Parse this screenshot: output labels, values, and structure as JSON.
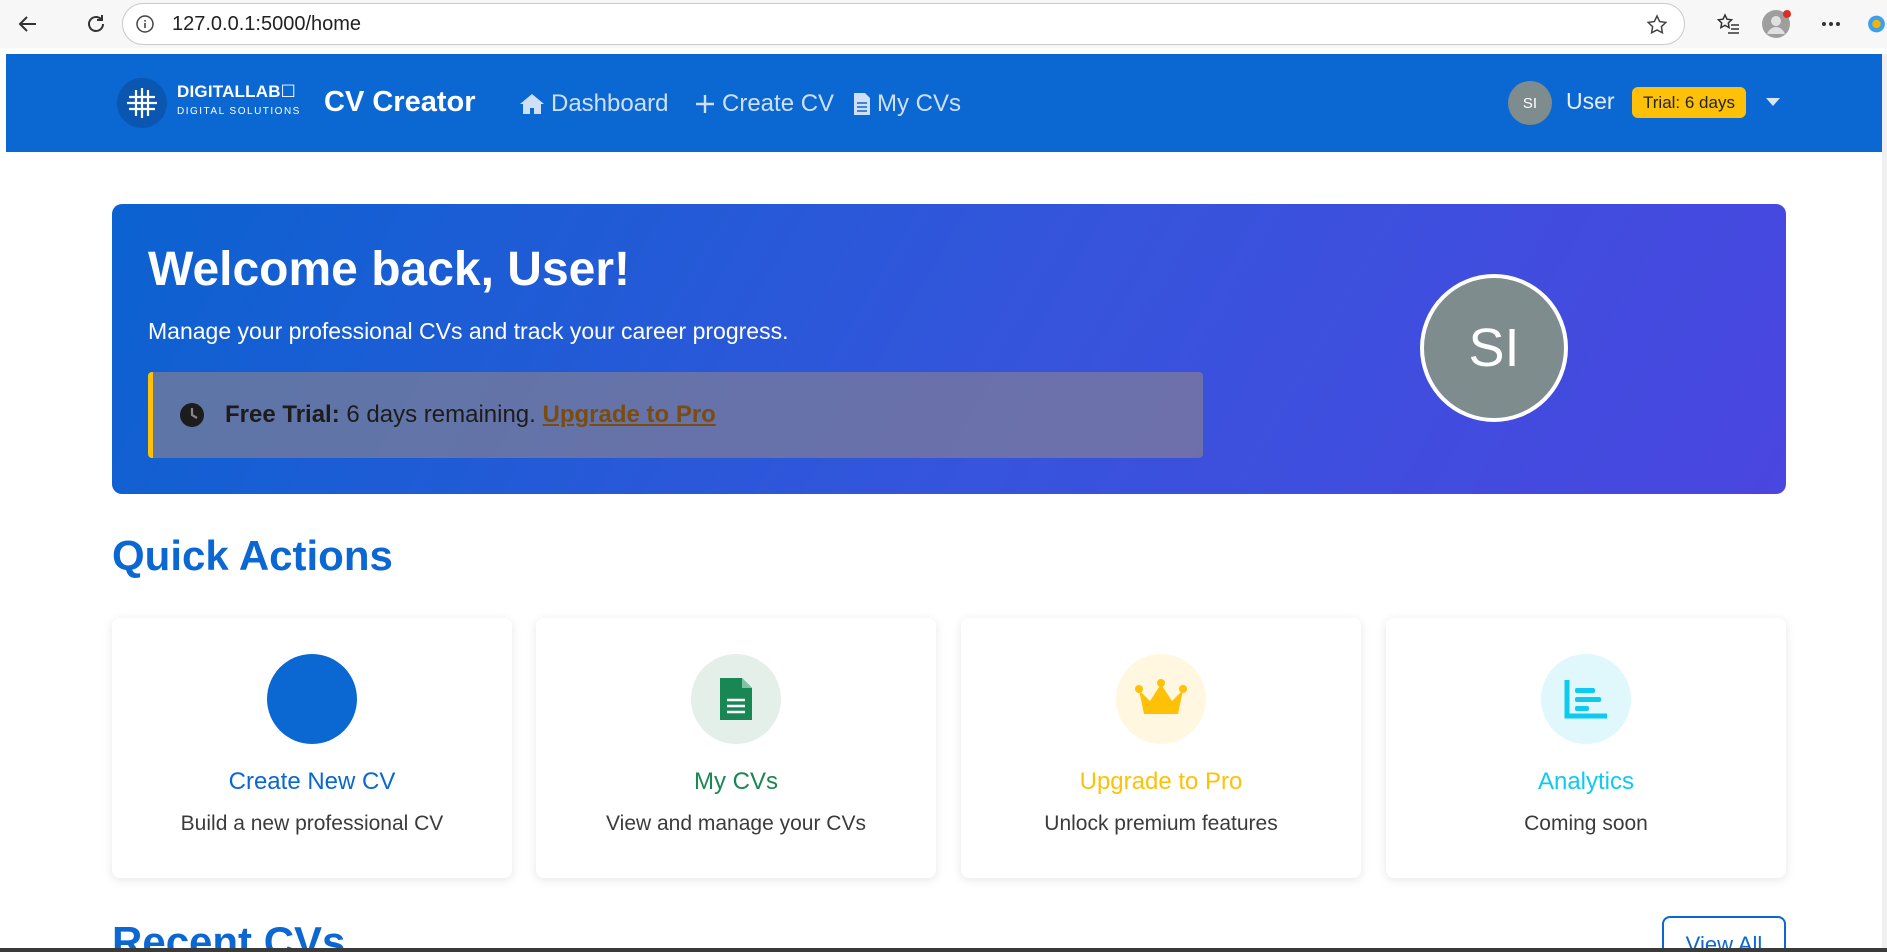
{
  "browser": {
    "url": "127.0.0.1:5000/home"
  },
  "navbar": {
    "logo_main": "DIGITALLAB☐",
    "logo_sub": "DIGITAL SOLUTIONS",
    "brand": "CV Creator",
    "links": [
      {
        "label": "Dashboard",
        "icon": "home-icon"
      },
      {
        "label": "Create CV",
        "icon": "plus-icon"
      },
      {
        "label": "My CVs",
        "icon": "file-icon"
      }
    ],
    "user_initials": "SI",
    "user_name": "User",
    "trial_badge": "Trial: 6 days"
  },
  "hero": {
    "title": "Welcome back, User!",
    "subtitle": "Manage your professional CVs and track your career progress.",
    "trial_label": "Free Trial:",
    "trial_remaining": " 6 days remaining. ",
    "upgrade_link": "Upgrade to Pro",
    "avatar_initials": "SI"
  },
  "quick_actions": {
    "title": "Quick Actions",
    "cards": [
      {
        "title": "Create New CV",
        "desc": "Build a new professional CV",
        "icon": "create-cv-icon",
        "color": "#0b67d1"
      },
      {
        "title": "My CVs",
        "desc": "View and manage your CVs",
        "icon": "document-icon",
        "color": "#198754"
      },
      {
        "title": "Upgrade to Pro",
        "desc": "Unlock premium features",
        "icon": "crown-icon",
        "color": "#ffc107"
      },
      {
        "title": "Analytics",
        "desc": "Coming soon",
        "icon": "chart-icon",
        "color": "#0dcaf0"
      }
    ]
  },
  "recent": {
    "title": "Recent CVs",
    "view_all": "View All"
  }
}
